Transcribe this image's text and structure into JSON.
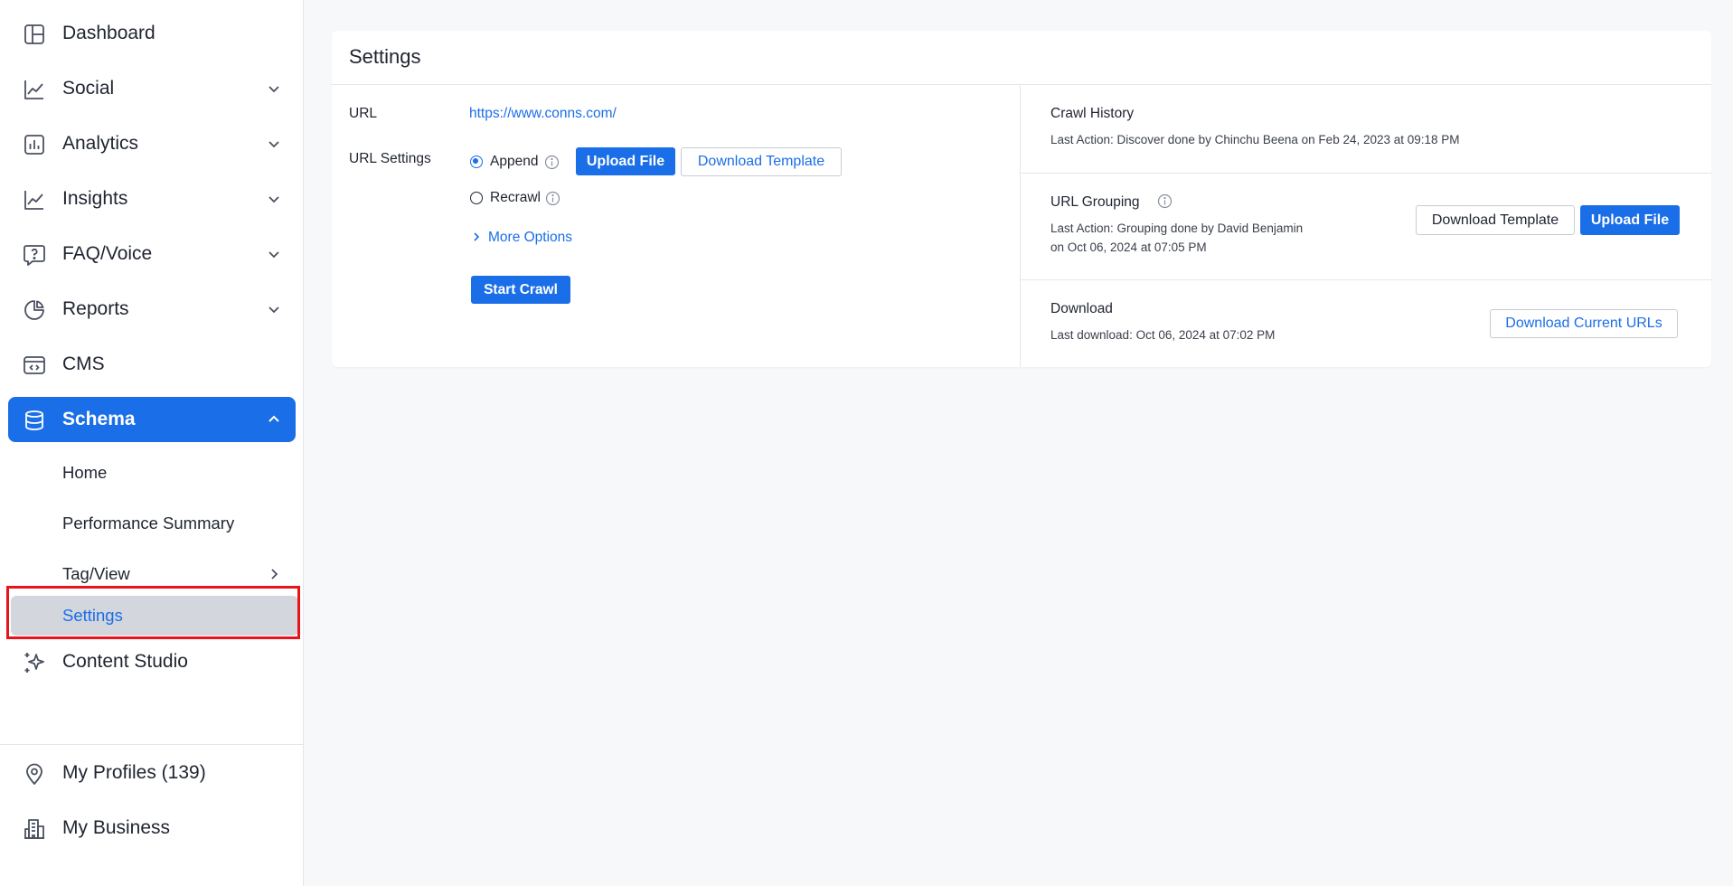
{
  "sidebar": {
    "nav": [
      {
        "label": "Dashboard",
        "icon": "dashboard-icon"
      },
      {
        "label": "Social",
        "icon": "line-chart-icon"
      },
      {
        "label": "Analytics",
        "icon": "bar-chart-icon"
      },
      {
        "label": "Insights",
        "icon": "line-chart-icon"
      },
      {
        "label": "FAQ/Voice",
        "icon": "question-bubble-icon"
      },
      {
        "label": "Reports",
        "icon": "pie-chart-icon"
      },
      {
        "label": "CMS",
        "icon": "code-window-icon"
      },
      {
        "label": "Schema",
        "icon": "database-icon"
      }
    ],
    "schema_sub": [
      {
        "label": "Home"
      },
      {
        "label": "Performance Summary"
      },
      {
        "label": "Tag/View"
      },
      {
        "label": "Settings"
      }
    ],
    "content_studio": {
      "label": "Content Studio",
      "icon": "sparkle-icon"
    },
    "profiles": {
      "label": "My Profiles (139)",
      "icon": "location-pin-icon"
    },
    "business": {
      "label": "My Business",
      "icon": "building-icon"
    }
  },
  "settings": {
    "title": "Settings",
    "url_label": "URL",
    "url_value": "https://www.conns.com/",
    "url_settings_label": "URL Settings",
    "append_label": "Append",
    "recrawl_label": "Recrawl",
    "upload_file": "Upload File",
    "download_template": "Download Template",
    "more_options": "More Options",
    "start_crawl": "Start Crawl",
    "crawl_history": {
      "title": "Crawl History",
      "text": "Last Action: Discover done by Chinchu Beena on Feb 24, 2023 at 09:18 PM"
    },
    "url_grouping": {
      "title": "URL Grouping",
      "text_line1": "Last Action: Grouping done by David Benjamin",
      "text_line2": "on Oct 06, 2024 at 07:05 PM",
      "download_template": "Download Template",
      "upload_file": "Upload File"
    },
    "download": {
      "title": "Download",
      "text": "Last download: Oct 06, 2024 at 07:02 PM",
      "button": "Download Current URLs"
    }
  },
  "colors": {
    "accent": "#1a6ee8",
    "highlight": "#e8141b",
    "selected_bg": "#d3d6dd"
  }
}
